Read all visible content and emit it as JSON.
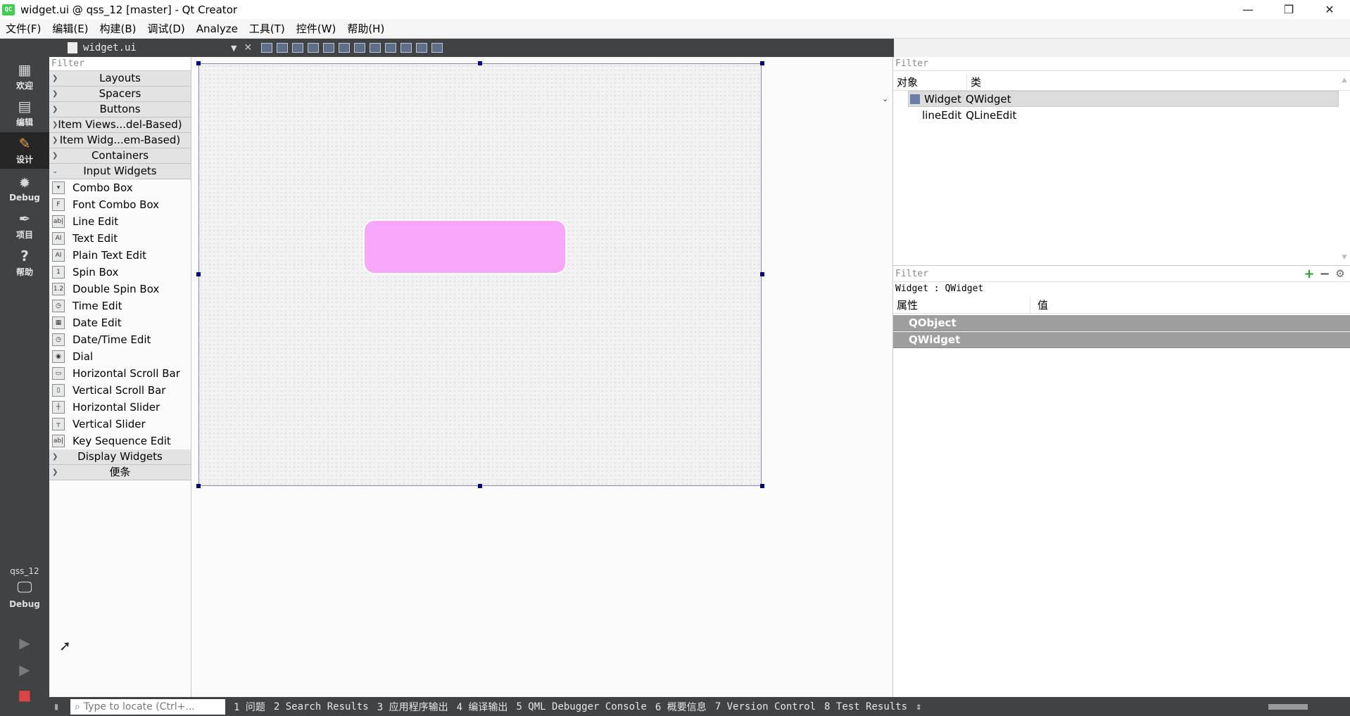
{
  "window": {
    "title": "widget.ui @ qss_12 [master] - Qt Creator",
    "app_icon": "QC",
    "minimize": "—",
    "maximize": "❐",
    "close": "✕"
  },
  "menu": [
    "文件(F)",
    "编辑(E)",
    "构建(B)",
    "调试(D)",
    "Analyze",
    "工具(T)",
    "控件(W)",
    "帮助(H)"
  ],
  "modes": [
    {
      "label": "欢迎",
      "icon": "grid-icon",
      "glyph": "▦"
    },
    {
      "label": "编辑",
      "icon": "edit-document-icon",
      "glyph": "▤"
    },
    {
      "label": "设计",
      "icon": "pencil-icon",
      "glyph": "✎"
    },
    {
      "label": "Debug",
      "icon": "bug-icon",
      "glyph": "✹"
    },
    {
      "label": "项目",
      "icon": "wrench-icon",
      "glyph": "✒"
    },
    {
      "label": "帮助",
      "icon": "help-icon",
      "glyph": "?"
    }
  ],
  "kit": {
    "project": "qss_12",
    "build": "Debug",
    "icon": "monitor-icon",
    "glyph": "🖵"
  },
  "editor_toolbar": {
    "filename": "widget.ui"
  },
  "widget_box": {
    "filter_placeholder": "Filter",
    "categories_top": [
      "Layouts",
      "Spacers",
      "Buttons",
      "Item Views...del-Based)",
      "Item Widg...em-Based)",
      "Containers"
    ],
    "input_category": "Input Widgets",
    "input_widgets": [
      {
        "label": "Combo Box",
        "icon": "combo-box-icon",
        "glyph": "▾"
      },
      {
        "label": "Font Combo Box",
        "icon": "font-combo-box-icon",
        "glyph": "F"
      },
      {
        "label": "Line Edit",
        "icon": "line-edit-icon",
        "glyph": "ab|"
      },
      {
        "label": "Text Edit",
        "icon": "text-edit-icon",
        "glyph": "AI"
      },
      {
        "label": "Plain Text Edit",
        "icon": "plain-text-edit-icon",
        "glyph": "AI"
      },
      {
        "label": "Spin Box",
        "icon": "spin-box-icon",
        "glyph": "1"
      },
      {
        "label": "Double Spin Box",
        "icon": "double-spin-box-icon",
        "glyph": "1.2"
      },
      {
        "label": "Time Edit",
        "icon": "clock-icon",
        "glyph": "◷"
      },
      {
        "label": "Date Edit",
        "icon": "calendar-icon",
        "glyph": "▦"
      },
      {
        "label": "Date/Time Edit",
        "icon": "date-time-icon",
        "glyph": "◷"
      },
      {
        "label": "Dial",
        "icon": "dial-icon",
        "glyph": "◉"
      },
      {
        "label": "Horizontal Scroll Bar",
        "icon": "horizontal-scroll-bar-icon",
        "glyph": "▭"
      },
      {
        "label": "Vertical Scroll Bar",
        "icon": "vertical-scroll-bar-icon",
        "glyph": "▯"
      },
      {
        "label": "Horizontal Slider",
        "icon": "horizontal-slider-icon",
        "glyph": "┼"
      },
      {
        "label": "Vertical Slider",
        "icon": "vertical-slider-icon",
        "glyph": "┬"
      },
      {
        "label": "Key Sequence Edit",
        "icon": "key-sequence-edit-icon",
        "glyph": "ab|"
      }
    ],
    "categories_bottom": [
      "Display Widgets",
      "便条"
    ]
  },
  "object_inspector": {
    "filter_placeholder": "Filter",
    "col_object": "对象",
    "col_class": "类",
    "rows": [
      {
        "object": "Widget",
        "class": "QWidget"
      },
      {
        "object": "lineEdit",
        "class": "QLineEdit"
      }
    ]
  },
  "property_editor": {
    "filter_placeholder": "Filter",
    "add": "+",
    "remove": "−",
    "configure": "⚙",
    "object_line": "Widget : QWidget",
    "col_property": "属性",
    "col_value": "值",
    "groups": [
      "QObject",
      "QWidget"
    ]
  },
  "statusbar": {
    "locate_placeholder": "Type to locate (Ctrl+...",
    "outputs": [
      "1 问题",
      "2 Search Results",
      "3 应用程序输出",
      "4 编译输出",
      "5 QML Debugger Console",
      "6 概要信息",
      "7 Version Control",
      "8 Test Results"
    ]
  },
  "colors": {
    "line_edit_fill": "#f8a6f8",
    "sidebar": "#404244",
    "selection_handle": "#00006e"
  }
}
